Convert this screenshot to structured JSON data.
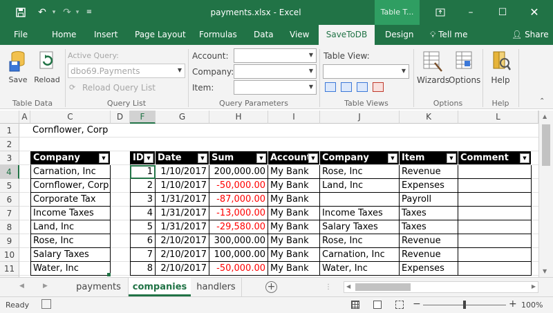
{
  "title": {
    "text": "payments.xlsx  -  Excel",
    "context_tab": "Table T..."
  },
  "ribbon_tabs": [
    "File",
    "Home",
    "Insert",
    "Page Layout",
    "Formulas",
    "Data",
    "View",
    "SaveToDB",
    "Design"
  ],
  "tell_me": "Tell me",
  "share": "Share",
  "ribbon": {
    "save": "Save",
    "reload": "Reload",
    "active_query_label": "Active Query:",
    "active_query_value": "dbo69.Payments",
    "reload_query_list": "Reload Query List",
    "account_label": "Account:",
    "company_label": "Company:",
    "item_label": "Item:",
    "table_view_label": "Table View:",
    "wizards": "Wizards",
    "options": "Options",
    "help": "Help",
    "groups": {
      "table_data": "Table Data",
      "query_list": "Query List",
      "query_parameters": "Query Parameters",
      "table_views": "Table Views",
      "options": "Options",
      "help": "Help"
    }
  },
  "columns": [
    "A",
    "C",
    "D",
    "F",
    "G",
    "H",
    "I",
    "J",
    "K",
    "L"
  ],
  "rows": [
    "1",
    "2",
    "3",
    "4",
    "5",
    "6",
    "7",
    "8",
    "9",
    "10",
    "11"
  ],
  "sheet_title": "Cornflower, Corp",
  "companies": {
    "header": "Company",
    "items": [
      "Carnation, Inc",
      "Cornflower, Corp",
      "Corporate Tax",
      "Income Taxes",
      "Land, Inc",
      "Rose, Inc",
      "Salary Taxes",
      "Water, Inc"
    ]
  },
  "payments": {
    "headers": [
      "ID",
      "Date",
      "Sum",
      "Account",
      "Company",
      "Item",
      "Comment"
    ],
    "rows": [
      {
        "id": "1",
        "date": "1/10/2017",
        "sum": "200,000.00",
        "account": "My Bank",
        "company": "Rose, Inc",
        "item": "Revenue",
        "comment": ""
      },
      {
        "id": "2",
        "date": "1/10/2017",
        "sum": "-50,000.00",
        "account": "My Bank",
        "company": "Land, Inc",
        "item": "Expenses",
        "comment": ""
      },
      {
        "id": "3",
        "date": "1/31/2017",
        "sum": "-87,000.00",
        "account": "My Bank",
        "company": "",
        "item": "Payroll",
        "comment": ""
      },
      {
        "id": "4",
        "date": "1/31/2017",
        "sum": "-13,000.00",
        "account": "My Bank",
        "company": "Income Taxes",
        "item": "Taxes",
        "comment": ""
      },
      {
        "id": "5",
        "date": "1/31/2017",
        "sum": "-29,580.00",
        "account": "My Bank",
        "company": "Salary Taxes",
        "item": "Taxes",
        "comment": ""
      },
      {
        "id": "6",
        "date": "2/10/2017",
        "sum": "300,000.00",
        "account": "My Bank",
        "company": "Rose, Inc",
        "item": "Revenue",
        "comment": ""
      },
      {
        "id": "7",
        "date": "2/10/2017",
        "sum": "100,000.00",
        "account": "My Bank",
        "company": "Carnation, Inc",
        "item": "Revenue",
        "comment": ""
      },
      {
        "id": "8",
        "date": "2/10/2017",
        "sum": "-50,000.00",
        "account": "My Bank",
        "company": "Water, Inc",
        "item": "Expenses",
        "comment": ""
      }
    ]
  },
  "sheets": [
    "payments",
    "companies",
    "handlers"
  ],
  "active_sheet": "companies",
  "status": {
    "ready": "Ready",
    "zoom": "100%"
  },
  "colors": {
    "accent": "#217346",
    "negative": "#ff0000",
    "table_header": "#000000"
  }
}
